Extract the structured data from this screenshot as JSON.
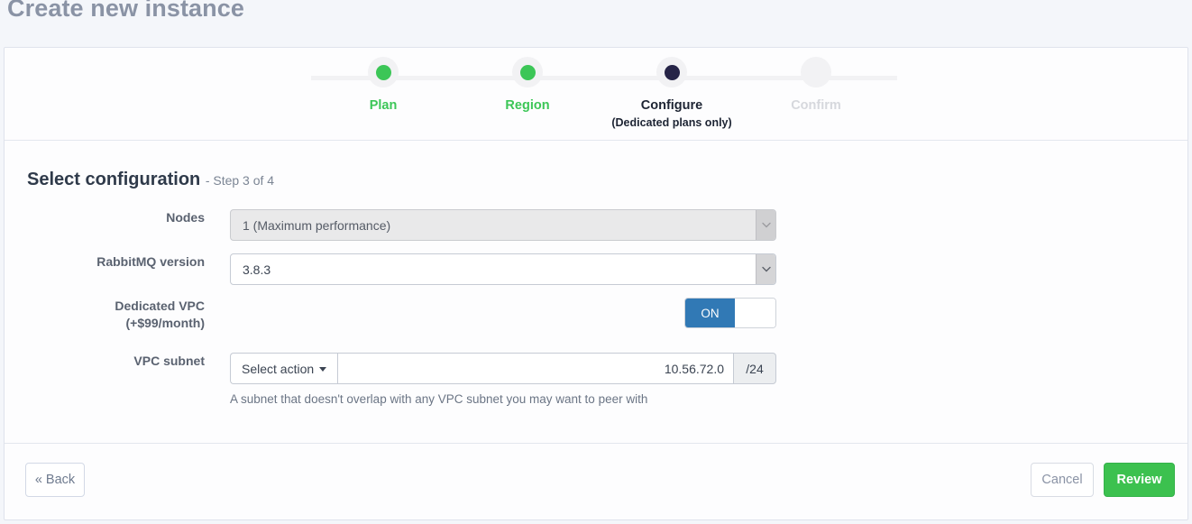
{
  "page": {
    "title": "Create new instance"
  },
  "stepper": {
    "steps": [
      {
        "label": "Plan",
        "sub": "",
        "state": "done",
        "dot": "green"
      },
      {
        "label": "Region",
        "sub": "",
        "state": "done",
        "dot": "green"
      },
      {
        "label": "Configure",
        "sub": "(Dedicated plans only)",
        "state": "current",
        "dot": "navy"
      },
      {
        "label": "Confirm",
        "sub": "",
        "state": "upcoming",
        "dot": "none"
      }
    ]
  },
  "section": {
    "title": "Select configuration",
    "step_of": "- Step 3 of 4"
  },
  "form": {
    "nodes": {
      "label": "Nodes",
      "value": "1 (Maximum performance)",
      "disabled": true
    },
    "version": {
      "label": "RabbitMQ version",
      "value": "3.8.3",
      "disabled": false
    },
    "vpc": {
      "label": "Dedicated VPC",
      "label_sub": "(+$99/month)",
      "toggle_state": "ON"
    },
    "subnet": {
      "label": "VPC subnet",
      "action_label": "Select action",
      "value": "10.56.72.0",
      "mask": "/24",
      "help": "A subnet that doesn't overlap with any VPC subnet you may want to peer with"
    }
  },
  "footer": {
    "back": "« Back",
    "cancel": "Cancel",
    "review": "Review"
  },
  "colors": {
    "page_bg": "#f4f6fa",
    "accent_green": "#3cc657",
    "accent_navy": "#262447",
    "toggle_blue": "#3179b5",
    "muted": "#d6d8dd"
  }
}
